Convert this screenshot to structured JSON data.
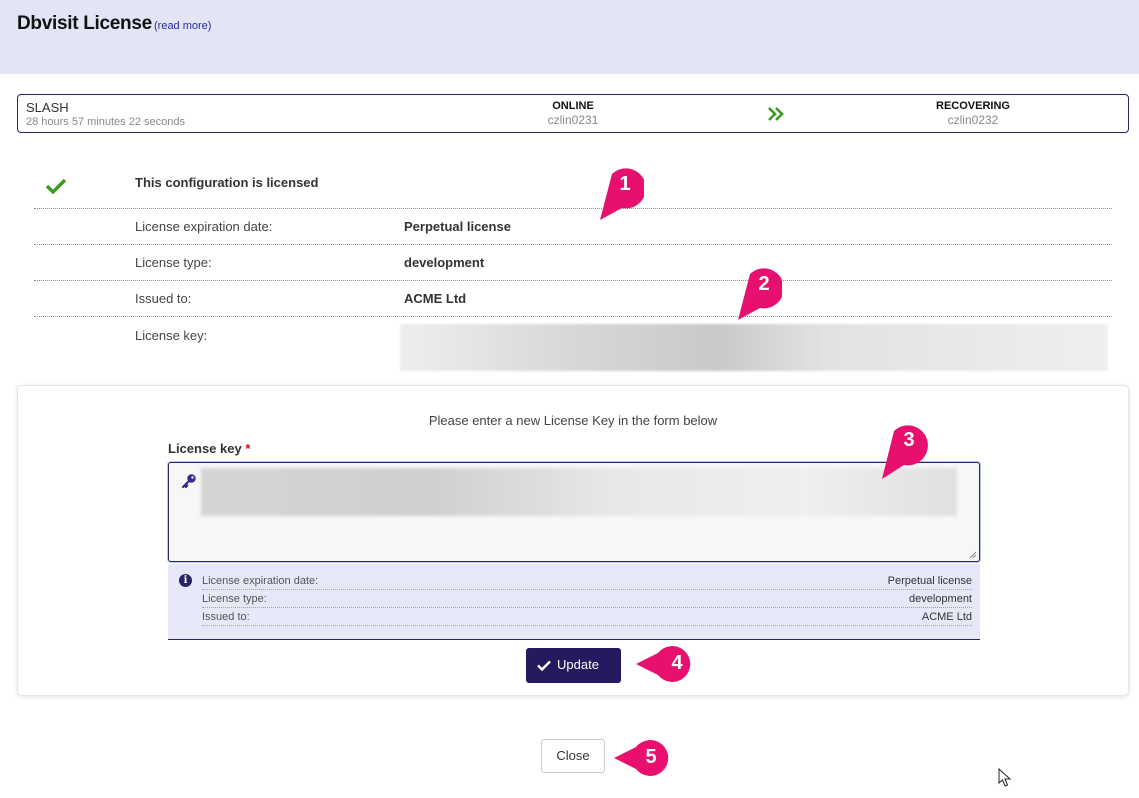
{
  "header": {
    "title": "Dbvisit License",
    "read_more": "(read more)"
  },
  "status_bar": {
    "name": "SLASH",
    "duration": "28 hours 57 minutes 22 seconds",
    "primary": {
      "role": "ONLINE",
      "host": "czlin0231"
    },
    "standby": {
      "role": "RECOVERING",
      "host": "czlin0232"
    },
    "arrow_icon": "double-chevron-right-icon"
  },
  "license_info": {
    "status": "This configuration is licensed",
    "status_icon": "check-icon",
    "rows": [
      {
        "label": "License expiration date:",
        "value": "Perpetual license"
      },
      {
        "label": "License type:",
        "value": "development"
      },
      {
        "label": "Issued to:",
        "value": "ACME Ltd"
      }
    ],
    "key_label": "License key:"
  },
  "form": {
    "instruction": "Please enter a new License Key in the form below",
    "field_label": "License key",
    "required_mark": "*",
    "key_icon": "key-icon",
    "preview": {
      "icon": "info-icon",
      "rows": [
        {
          "label": "License expiration date:",
          "value": "Perpetual license"
        },
        {
          "label": "License type:",
          "value": "development"
        },
        {
          "label": "Issued to:",
          "value": "ACME Ltd"
        }
      ]
    },
    "update_label": "Update"
  },
  "close_label": "Close",
  "markers": [
    "1",
    "2",
    "3",
    "4",
    "5"
  ],
  "colors": {
    "header_bg": "#e3e4f6",
    "primary": "#241a5e",
    "success": "#3c9a1c",
    "marker": "#e8106e"
  }
}
